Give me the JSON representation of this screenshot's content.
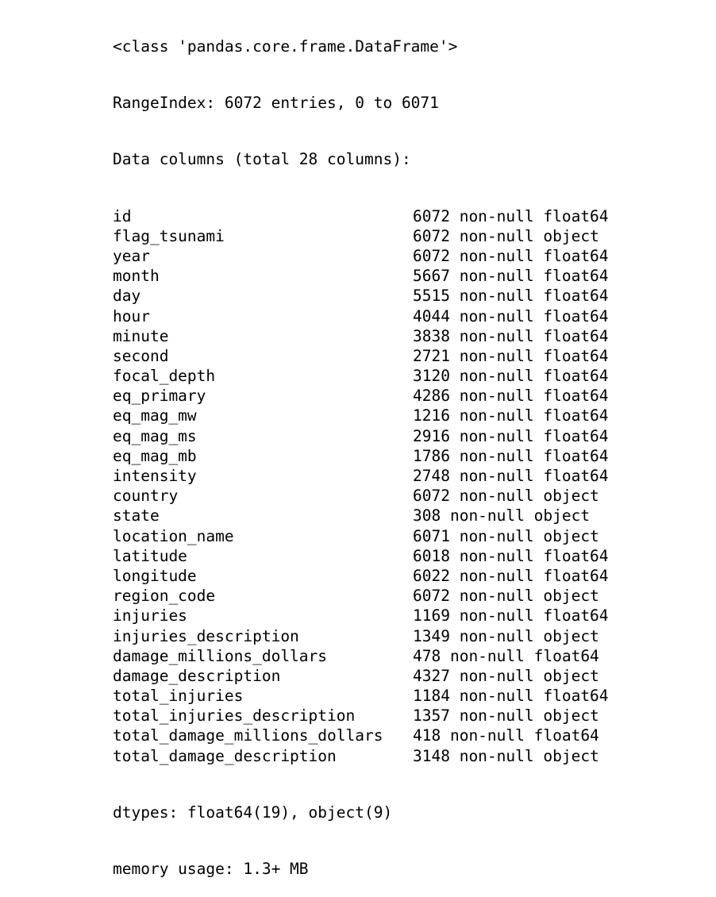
{
  "header": {
    "class_line": "<class 'pandas.core.frame.DataFrame'>",
    "range_index": "RangeIndex: 6072 entries, 0 to 6071",
    "data_columns": "Data columns (total 28 columns):"
  },
  "columns": [
    {
      "name": "id",
      "info": "6072 non-null float64"
    },
    {
      "name": "flag_tsunami",
      "info": "6072 non-null object"
    },
    {
      "name": "year",
      "info": "6072 non-null float64"
    },
    {
      "name": "month",
      "info": "5667 non-null float64"
    },
    {
      "name": "day",
      "info": "5515 non-null float64"
    },
    {
      "name": "hour",
      "info": "4044 non-null float64"
    },
    {
      "name": "minute",
      "info": "3838 non-null float64"
    },
    {
      "name": "second",
      "info": "2721 non-null float64"
    },
    {
      "name": "focal_depth",
      "info": "3120 non-null float64"
    },
    {
      "name": "eq_primary",
      "info": "4286 non-null float64"
    },
    {
      "name": "eq_mag_mw",
      "info": "1216 non-null float64"
    },
    {
      "name": "eq_mag_ms",
      "info": "2916 non-null float64"
    },
    {
      "name": "eq_mag_mb",
      "info": "1786 non-null float64"
    },
    {
      "name": "intensity",
      "info": "2748 non-null float64"
    },
    {
      "name": "country",
      "info": "6072 non-null object"
    },
    {
      "name": "state",
      "info": "308 non-null object"
    },
    {
      "name": "location_name",
      "info": "6071 non-null object"
    },
    {
      "name": "latitude",
      "info": "6018 non-null float64"
    },
    {
      "name": "longitude",
      "info": "6022 non-null float64"
    },
    {
      "name": "region_code",
      "info": "6072 non-null object"
    },
    {
      "name": "injuries",
      "info": "1169 non-null float64"
    },
    {
      "name": "injuries_description",
      "info": "1349 non-null object"
    },
    {
      "name": "damage_millions_dollars",
      "info": "478 non-null float64"
    },
    {
      "name": "damage_description",
      "info": "4327 non-null object"
    },
    {
      "name": "total_injuries",
      "info": "1184 non-null float64"
    },
    {
      "name": "total_injuries_description",
      "info": "1357 non-null object"
    },
    {
      "name": "total_damage_millions_dollars",
      "info": "418 non-null float64"
    },
    {
      "name": "total_damage_description",
      "info": "3148 non-null object"
    }
  ],
  "footer": {
    "dtypes": "dtypes: float64(19), object(9)",
    "memory": "memory usage: 1.3+ MB"
  }
}
